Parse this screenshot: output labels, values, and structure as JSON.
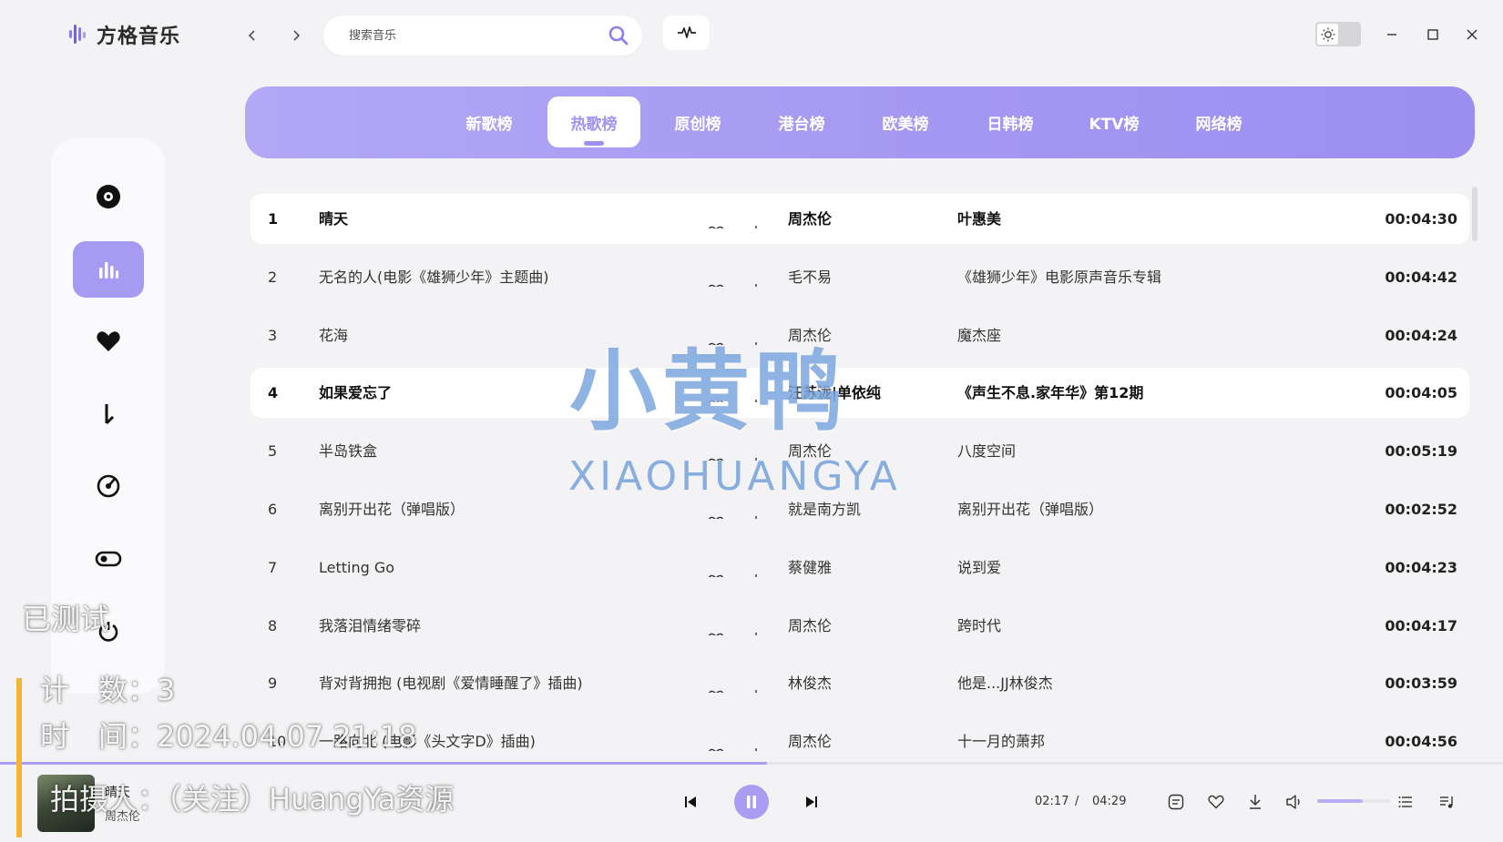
{
  "app": {
    "name": "方格音乐"
  },
  "search": {
    "placeholder": "搜索音乐",
    "value": ""
  },
  "tabs": [
    {
      "label": "新歌榜",
      "active": false
    },
    {
      "label": "热歌榜",
      "active": true
    },
    {
      "label": "原创榜",
      "active": false
    },
    {
      "label": "港台榜",
      "active": false
    },
    {
      "label": "欧美榜",
      "active": false
    },
    {
      "label": "日韩榜",
      "active": false
    },
    {
      "label": "KTV榜",
      "active": false
    },
    {
      "label": "网络榜",
      "active": false
    }
  ],
  "sidebar": {
    "items": [
      {
        "icon": "disc-icon",
        "active": false
      },
      {
        "icon": "chart-bars-icon",
        "active": true
      },
      {
        "icon": "heart-icon",
        "active": false
      },
      {
        "icon": "download-icon",
        "active": false
      },
      {
        "icon": "radar-icon",
        "active": false
      },
      {
        "icon": "toggle-icon",
        "active": false
      },
      {
        "icon": "power-icon",
        "active": false
      }
    ]
  },
  "songs": [
    {
      "num": "1",
      "title": "晴天",
      "artist": "周杰伦",
      "album": "叶惠美",
      "duration": "00:04:30",
      "highlight": true
    },
    {
      "num": "2",
      "title": "无名的人(电影《雄狮少年》主题曲)",
      "artist": "毛不易",
      "album": "《雄狮少年》电影原声音乐专辑",
      "duration": "00:04:42",
      "highlight": false
    },
    {
      "num": "3",
      "title": "花海",
      "artist": "周杰伦",
      "album": "魔杰座",
      "duration": "00:04:24",
      "highlight": false
    },
    {
      "num": "4",
      "title": "如果爱忘了",
      "artist": "汪苏泷|单依纯",
      "album": "《声生不息.家年华》第12期",
      "duration": "00:04:05",
      "highlight": true
    },
    {
      "num": "5",
      "title": "半岛铁盒",
      "artist": "周杰伦",
      "album": "八度空间",
      "duration": "00:05:19",
      "highlight": false
    },
    {
      "num": "6",
      "title": "离别开出花（弹唱版）",
      "artist": "就是南方凯",
      "album": "离别开出花（弹唱版）",
      "duration": "00:02:52",
      "highlight": false
    },
    {
      "num": "7",
      "title": "Letting Go",
      "artist": "蔡健雅",
      "album": "说到爱",
      "duration": "00:04:23",
      "highlight": false
    },
    {
      "num": "8",
      "title": "我落泪情绪零碎",
      "artist": "周杰伦",
      "album": "跨时代",
      "duration": "00:04:17",
      "highlight": false
    },
    {
      "num": "9",
      "title": "背对背拥抱 (电视剧《爱情睡醒了》插曲)",
      "artist": "林俊杰",
      "album": "他是...JJ林俊杰",
      "duration": "00:03:59",
      "highlight": false
    },
    {
      "num": "10",
      "title": "一路向北 (电影《头文字D》插曲)",
      "artist": "周杰伦",
      "album": "十一月的萧邦",
      "duration": "00:04:56",
      "highlight": false
    }
  ],
  "player": {
    "title": "晴天",
    "artist": "周杰伦",
    "current_time": "02:17",
    "separator": "/",
    "total_time": "04:29",
    "progress_fraction": 0.51,
    "volume_fraction": 0.62
  },
  "watermark": {
    "main": "小黄鸭",
    "latin": "XIAOHUANGYA",
    "tested": "已测试",
    "count": "计　数：3",
    "time": "时　间：2024.04.07 21:18",
    "photographer": "拍摄人：（关注）HuangYa资源"
  },
  "colors": {
    "accent": "#a99cf2",
    "tab_gradient_start": "#b2a8f6",
    "tab_gradient_end": "#9c8ef0",
    "watermark_bar": "#f2b632"
  }
}
